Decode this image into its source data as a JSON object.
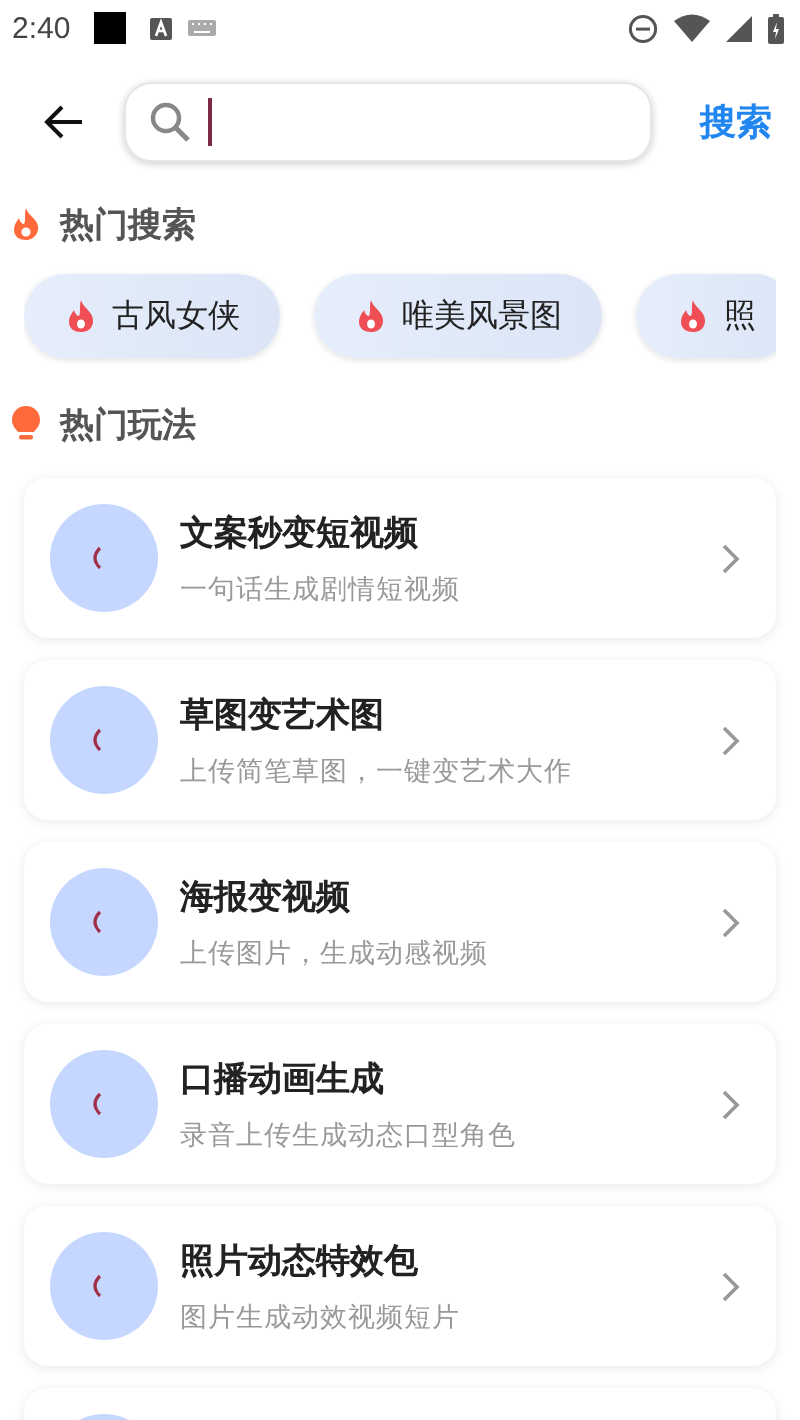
{
  "status_bar": {
    "time": "2:40"
  },
  "search": {
    "button": "搜索"
  },
  "hot_search": {
    "title": "热门搜索",
    "chips": [
      "古风女侠",
      "唯美风景图",
      "照"
    ]
  },
  "hot_play": {
    "title": "热门玩法",
    "cards": [
      {
        "title": "文案秒变短视频",
        "subtitle": "一句话生成剧情短视频"
      },
      {
        "title": "草图变艺术图",
        "subtitle": "上传简笔草图，一键变艺术大作"
      },
      {
        "title": "海报变视频",
        "subtitle": "上传图片，生成动感视频"
      },
      {
        "title": "口播动画生成",
        "subtitle": "录音上传生成动态口型角色"
      },
      {
        "title": "照片动态特效包",
        "subtitle": "图片生成动效视频短片"
      }
    ]
  }
}
